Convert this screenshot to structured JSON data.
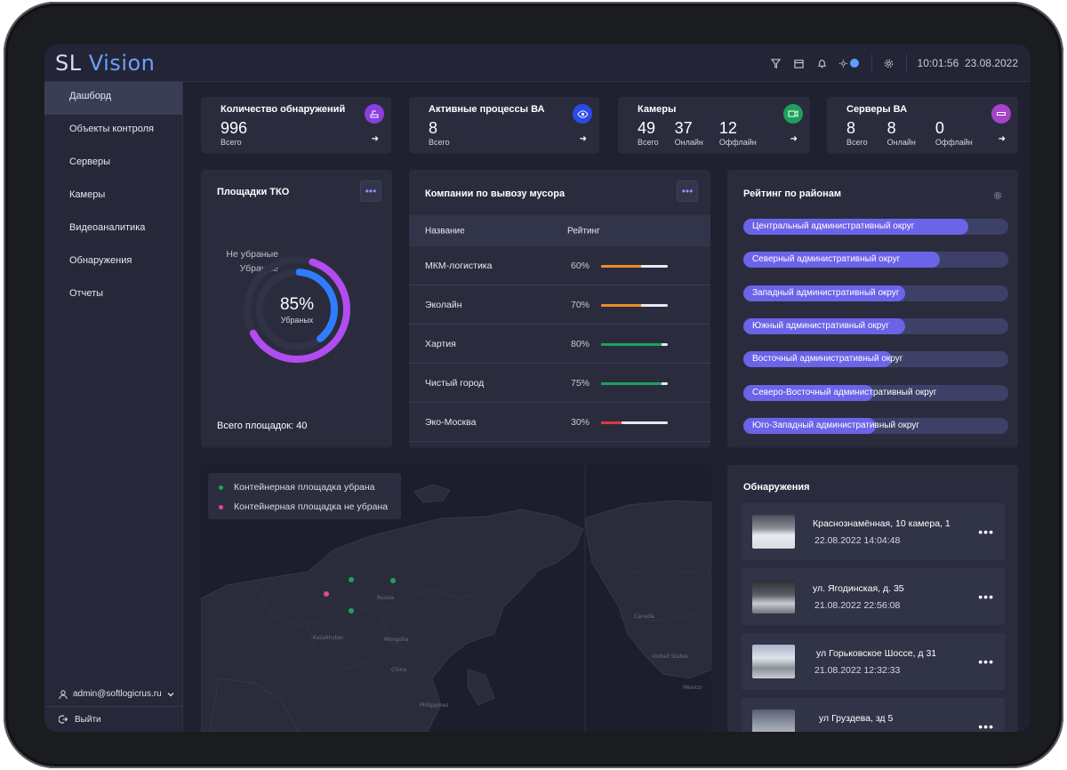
{
  "app": {
    "logo_main": "SL",
    "logo_accent": "Vision"
  },
  "header": {
    "time": "10:01:56",
    "date": "23.08.2022"
  },
  "sidebar": {
    "items": [
      {
        "label": "Дашборд"
      },
      {
        "label": "Объекты контроля"
      },
      {
        "label": "Серверы"
      },
      {
        "label": "Камеры"
      },
      {
        "label": "Видеоаналитика"
      },
      {
        "label": "Обнаружения"
      },
      {
        "label": "Отчеты"
      }
    ],
    "user": "admin@softlogicrus.ru",
    "logout": "Выйти"
  },
  "stats": {
    "detections": {
      "title": "Количество обнаружений",
      "value": "996",
      "label": "Всего"
    },
    "processes": {
      "title": "Активные процессы ВА",
      "value": "8",
      "label": "Всего"
    },
    "cameras": {
      "title": "Камеры",
      "total": "49",
      "total_label": "Всего",
      "online": "37",
      "online_label": "Онлайн",
      "offline": "12",
      "offline_label": "Оффлайн"
    },
    "servers": {
      "title": "Серверы ВА",
      "total": "8",
      "total_label": "Всего",
      "online": "8",
      "online_label": "Онлайн",
      "offline": "0",
      "offline_label": "Оффлайн"
    }
  },
  "tko": {
    "title": "Площадки ТКО",
    "legend_not_removed": "Не убраные",
    "legend_removed": "Убраные",
    "percent": "85%",
    "percent_label": "Убраных",
    "removed_fraction": 0.85,
    "total": "Всего площадок: 40"
  },
  "companies": {
    "title": "Компании по вывозу мусора",
    "col_name": "Название",
    "col_rating": "Рейтинг",
    "rows": [
      {
        "name": "МКМ-логистика",
        "pct": "60%",
        "value": 0.6,
        "color": "#f08a2c"
      },
      {
        "name": "Эколайн",
        "pct": "70%",
        "value": 0.6,
        "color": "#f08a2c"
      },
      {
        "name": "Хартия",
        "pct": "80%",
        "value": 0.9,
        "color": "#1fa05e"
      },
      {
        "name": "Чистый город",
        "pct": "75%",
        "value": 0.9,
        "color": "#1fa05e"
      },
      {
        "name": "Эко-Москва",
        "pct": "30%",
        "value": 0.3,
        "color": "#e03838"
      }
    ]
  },
  "districts": {
    "title": "Рейтинг по районам",
    "items": [
      {
        "label": "Центральный административный округ",
        "value": 0.85
      },
      {
        "label": "Северный административный округ",
        "value": 0.74
      },
      {
        "label": "Западный административный округ",
        "value": 0.61
      },
      {
        "label": "Южный административный округ",
        "value": 0.61
      },
      {
        "label": "Восточный административный округ",
        "value": 0.56
      },
      {
        "label": "Северо-Восточный административный округ",
        "value": 0.49
      },
      {
        "label": "Юго-Западный административный округ",
        "value": 0.5
      }
    ]
  },
  "map": {
    "legend_removed": "Контейнерная площадка убрана",
    "legend_not_removed": "Контейнерная площадка не убрана",
    "removed_color": "#1fa05e",
    "not_removed_color": "#e0489a",
    "labels": [
      "Russia",
      "Kazakhstan",
      "Mongolia",
      "China",
      "Canada",
      "United States",
      "Mexico",
      "Philippines"
    ]
  },
  "detections": {
    "title": "Обнаружения",
    "items": [
      {
        "address": "Краснознамённая, 10 камера, 1",
        "time": "22.08.2022 14:04:48"
      },
      {
        "address": "ул. Ягодинская, д. 35",
        "time": "21.08.2022 22:56:08"
      },
      {
        "address": "ул Горьковское Шоссе, д 31",
        "time": "21.08.2022 12:32:33"
      },
      {
        "address": "ул Груздева, зд 5",
        "time": ""
      }
    ]
  },
  "colors": {
    "accent": "#6b63e8",
    "blue": "#2f7dff",
    "purple": "#a855f7"
  }
}
